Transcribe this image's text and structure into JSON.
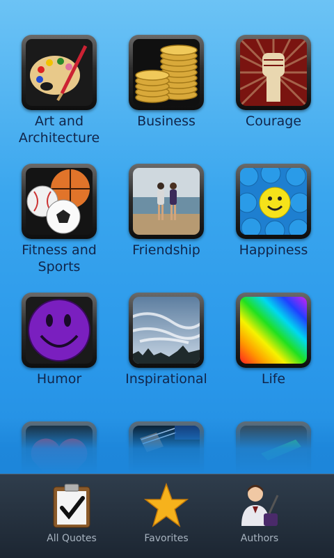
{
  "categories": [
    {
      "label": "Art and Architecture",
      "icon": "palette-icon"
    },
    {
      "label": "Business",
      "icon": "gold-coins-icon"
    },
    {
      "label": "Courage",
      "icon": "raised-fist-icon"
    },
    {
      "label": "Fitness and Sports",
      "icon": "sports-balls-icon"
    },
    {
      "label": "Friendship",
      "icon": "friends-on-beach-icon"
    },
    {
      "label": "Happiness",
      "icon": "smiley-crowd-icon"
    },
    {
      "label": "Humor",
      "icon": "purple-smiley-icon"
    },
    {
      "label": "Inspirational",
      "icon": "sky-clouds-icon"
    },
    {
      "label": "Life",
      "icon": "rainbow-gradient-icon"
    },
    {
      "label": "",
      "icon": "heart-icon"
    },
    {
      "label": "",
      "icon": "guitar-icon"
    },
    {
      "label": "",
      "icon": "green-arrow-icon"
    }
  ],
  "tabs": [
    {
      "label": "All Quotes",
      "icon": "clipboard-check-icon"
    },
    {
      "label": "Favorites",
      "icon": "star-icon"
    },
    {
      "label": "Authors",
      "icon": "author-person-icon"
    }
  ]
}
